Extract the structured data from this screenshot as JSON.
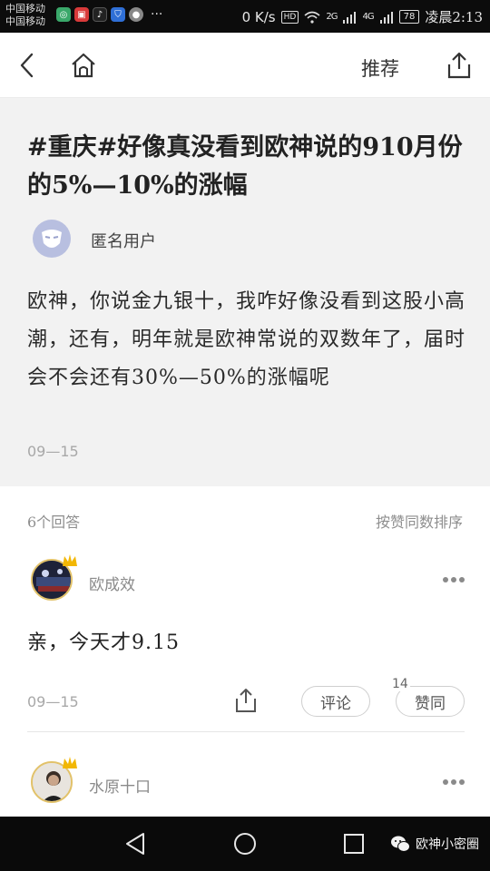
{
  "status_bar": {
    "carrier_1": "中国移动",
    "carrier_2": "中国移动",
    "net_speed": "0 K/s",
    "hd": "HD",
    "signal_1": "2G",
    "signal_2": "4G",
    "battery": "78",
    "time": "凌晨2:13",
    "more": "···"
  },
  "header": {
    "recommend_label": "推荐",
    "back_icon": "chevron-left-icon",
    "home_icon": "home-icon",
    "share_icon": "share-icon"
  },
  "question": {
    "title": "#重庆#好像真没看到欧神说的910月份的5%—10%的涨幅",
    "user": "匿名用户",
    "body": "欧神，你说金九银十，我咋好像没看到这股小高潮，还有，明年就是欧神常说的双数年了，届时会不会还有30%—50%的涨幅呢",
    "date": "09—15"
  },
  "answers_meta": {
    "count_label": "6个回答",
    "sort_label": "按赞同数排序"
  },
  "answers": [
    {
      "user": "欧成效",
      "content": "亲，今天才9.15",
      "date": "09—15",
      "comment_label": "评论",
      "like_label": "赞同",
      "like_count": "14"
    },
    {
      "user": "水原十口"
    }
  ],
  "watermark": {
    "text": "欧神小密圈"
  },
  "colors": {
    "status_bg": "#0c0c0c",
    "question_bg": "#f2f2f2",
    "avatar_bg": "#b8bfe0",
    "crown": "#f2b705"
  }
}
